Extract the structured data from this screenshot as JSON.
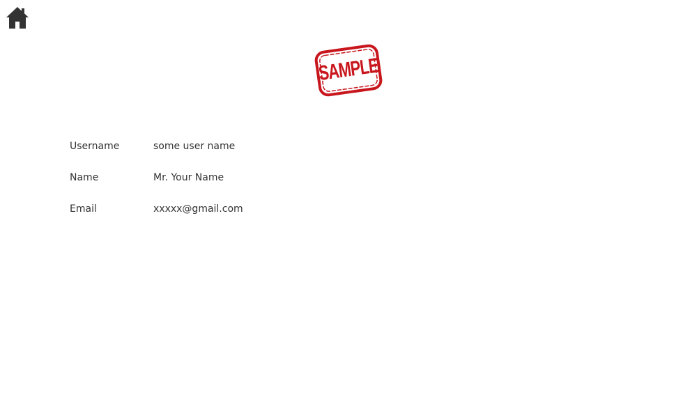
{
  "nav": {
    "home_icon": "home-icon"
  },
  "stamp": {
    "text": "SAMPLE",
    "color": "#c8161d"
  },
  "profile": {
    "rows": [
      {
        "label": "Username",
        "value": "some user name"
      },
      {
        "label": "Name",
        "value": "Mr. Your Name"
      },
      {
        "label": "Email",
        "value": "xxxxx@gmail.com"
      }
    ]
  }
}
